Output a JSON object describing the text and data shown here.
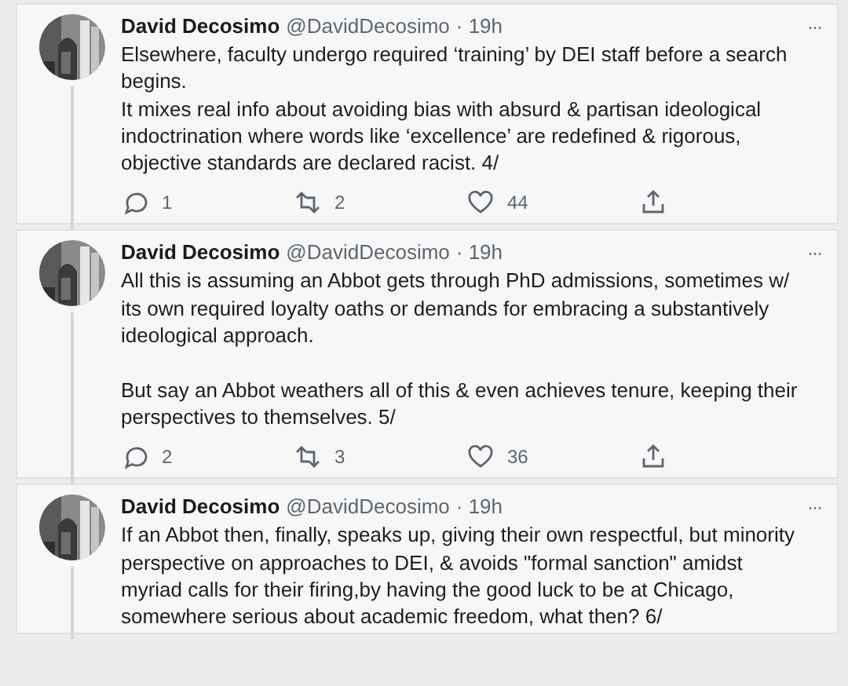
{
  "tweets": [
    {
      "name": "David Decosimo",
      "handle": "@DavidDecosimo",
      "time": "· 19h",
      "more": "···",
      "text": "Elsewhere, faculty undergo required ‘training’ by DEI staff before a search begins.\nIt mixes real info about avoiding bias with absurd & partisan ideological indoctrination where words like ‘excellence’ are redefined & rigorous, objective standards are declared racist. 4/",
      "actions": [
        {
          "kind": "reply",
          "count": "1"
        },
        {
          "kind": "retweet",
          "count": "2"
        },
        {
          "kind": "like",
          "count": "44"
        },
        {
          "kind": "share"
        }
      ]
    },
    {
      "name": "David Decosimo",
      "handle": "@DavidDecosimo",
      "time": "· 19h",
      "more": "···",
      "text": "All this is assuming an Abbot gets through PhD admissions, sometimes w/ its own required loyalty oaths or demands for embracing a substantively ideological approach.\n\nBut say an Abbot weathers all of this & even achieves tenure, keeping their perspectives to themselves. 5/",
      "actions": [
        {
          "kind": "reply",
          "count": "2"
        },
        {
          "kind": "retweet",
          "count": "3"
        },
        {
          "kind": "like",
          "count": "36"
        },
        {
          "kind": "share"
        }
      ]
    },
    {
      "name": "David Decosimo",
      "handle": "@DavidDecosimo",
      "time": "· 19h",
      "more": "···",
      "text": "If an Abbot then, finally, speaks up, giving their own respectful, but minority perspective on approaches to DEI, & avoids \"formal sanction\" amidst myriad calls for their firing,by having the good luck to be at Chicago, somewhere serious about academic freedom, what then? 6/"
    }
  ]
}
